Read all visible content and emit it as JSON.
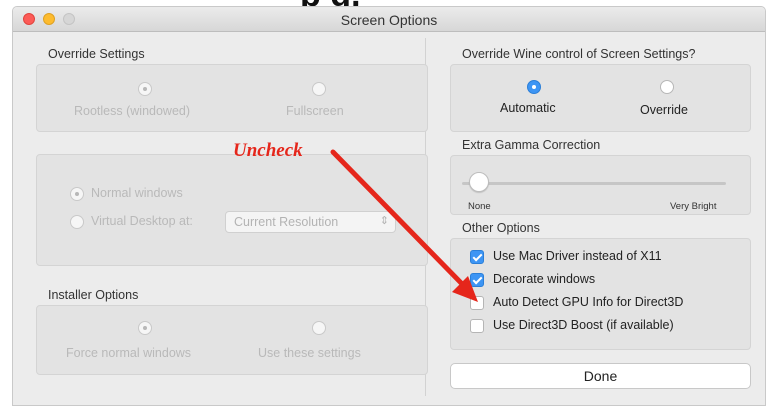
{
  "window": {
    "title": "Screen Options",
    "top_cut_text": "p    g,"
  },
  "left": {
    "override_settings": {
      "label": "Override Settings",
      "options": [
        "Rootless (windowed)",
        "Fullscreen"
      ]
    },
    "desktop": {
      "options": [
        "Normal windows",
        "Virtual Desktop at:"
      ],
      "resolution_value": "Current Resolution"
    },
    "installer": {
      "label": "Installer Options",
      "options": [
        "Force normal windows",
        "Use these settings"
      ]
    }
  },
  "right": {
    "wine_control": {
      "label": "Override Wine control of Screen Settings?",
      "options": [
        "Automatic",
        "Override"
      ]
    },
    "gamma": {
      "label": "Extra Gamma Correction",
      "min_label": "None",
      "max_label": "Very Bright",
      "value": 0
    },
    "other": {
      "label": "Other Options",
      "items": [
        {
          "label": "Use Mac Driver instead of X11",
          "checked": true
        },
        {
          "label": "Decorate windows",
          "checked": true
        },
        {
          "label": "Auto Detect GPU Info for Direct3D",
          "checked": false
        },
        {
          "label": "Use Direct3D Boost (if available)",
          "checked": false
        }
      ]
    },
    "done_label": "Done"
  },
  "annotation": {
    "text": "Uncheck",
    "color": "#e5261b"
  },
  "colors": {
    "accent": "#3d95f4"
  }
}
